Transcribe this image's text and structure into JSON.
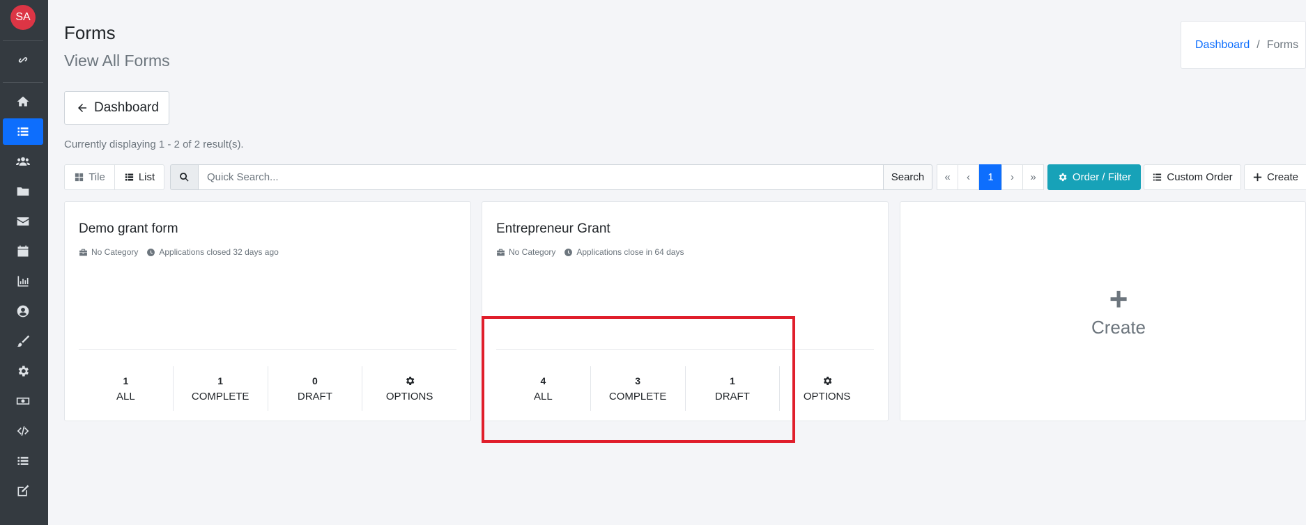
{
  "sidebar": {
    "avatar_initials": "SA",
    "items": [
      {
        "icon": "link-icon"
      },
      {
        "icon": "home-icon"
      },
      {
        "icon": "list-icon",
        "active": true
      },
      {
        "icon": "users-icon"
      },
      {
        "icon": "folder-icon"
      },
      {
        "icon": "envelope-icon"
      },
      {
        "icon": "calendar-icon"
      },
      {
        "icon": "chart-icon"
      },
      {
        "icon": "user-circle-icon"
      },
      {
        "icon": "brush-icon"
      },
      {
        "icon": "gear-icon"
      },
      {
        "icon": "money-icon"
      },
      {
        "icon": "code-icon"
      },
      {
        "icon": "list-icon"
      },
      {
        "icon": "edit-icon"
      }
    ]
  },
  "header": {
    "title": "Forms",
    "subtitle": "View All Forms"
  },
  "breadcrumb": {
    "link": "Dashboard",
    "separator": "/",
    "current": "Forms"
  },
  "back_button": {
    "label": "Dashboard"
  },
  "result_count": "Currently displaying 1 - 2 of 2 result(s).",
  "toolbar": {
    "tile_label": "Tile",
    "list_label": "List",
    "search_placeholder": "Quick Search...",
    "search_button": "Search",
    "pager": {
      "first": "«",
      "prev": "‹",
      "current": "1",
      "next": "›",
      "last": "»"
    },
    "order_filter_label": "Order / Filter",
    "custom_order_label": "Custom Order",
    "create_label": "Create"
  },
  "cards": [
    {
      "title": "Demo grant form",
      "category": "No Category",
      "status": "Applications closed 32 days ago",
      "stats": {
        "all_count": "1",
        "all_label": "ALL",
        "complete_count": "1",
        "complete_label": "COMPLETE",
        "draft_count": "0",
        "draft_label": "DRAFT",
        "options_label": "OPTIONS"
      }
    },
    {
      "title": "Entrepreneur Grant",
      "category": "No Category",
      "status": "Applications close in 64 days",
      "stats": {
        "all_count": "4",
        "all_label": "ALL",
        "complete_count": "3",
        "complete_label": "COMPLETE",
        "draft_count": "1",
        "draft_label": "DRAFT",
        "options_label": "OPTIONS"
      }
    }
  ],
  "create_card": {
    "plus": "+",
    "label": "Create"
  },
  "colors": {
    "sidebar_bg": "#343a40",
    "accent": "#0d6efd",
    "info": "#17a2b8",
    "highlight": "#e01e2b",
    "avatar": "#dc3545"
  }
}
